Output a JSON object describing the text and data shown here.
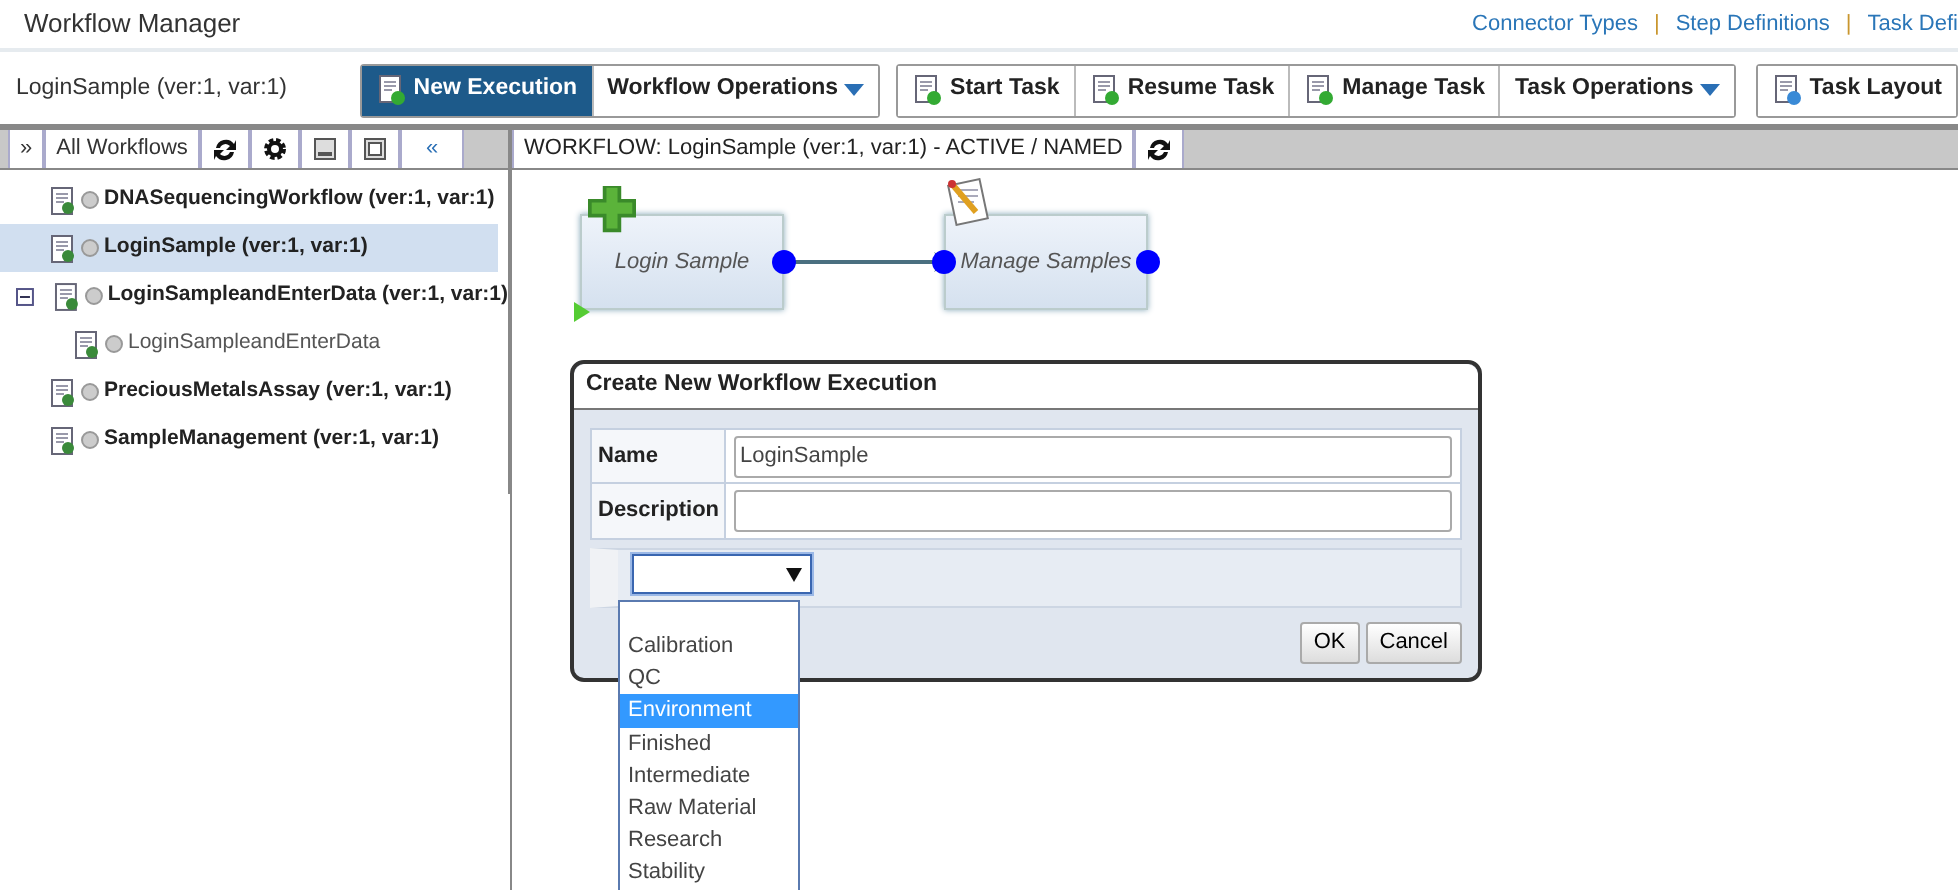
{
  "app_title": "Workflow Manager",
  "header_links": [
    "Connector Types",
    "Step Definitions",
    "Task Defi"
  ],
  "link_separator": "|",
  "current_workflow": "LoginSample (ver:1, var:1)",
  "workflow_buttons": [
    {
      "label": "New Execution",
      "kind": "action",
      "active": true
    },
    {
      "label": "Workflow Operations",
      "kind": "dropdown",
      "active": false
    }
  ],
  "task_buttons": [
    {
      "label": "Start Task",
      "kind": "action"
    },
    {
      "label": "Resume Task",
      "kind": "action"
    },
    {
      "label": "Manage Task",
      "kind": "action"
    },
    {
      "label": "Task Operations",
      "kind": "dropdown"
    }
  ],
  "layout_button": "Task Layout",
  "sidebar": {
    "expand_glyph": "»",
    "filter_label": "All Workflows",
    "collapse_glyph": "«",
    "items": [
      {
        "label": "DNASequencingWorkflow (ver:1, var:1)",
        "selected": false
      },
      {
        "label": "LoginSample (ver:1, var:1)",
        "selected": true
      },
      {
        "label": "LoginSampleandEnterData (ver:1, var:1)",
        "selected": false,
        "expanded": true,
        "children": [
          {
            "label": "LoginSampleandEnterData",
            "selected": false
          }
        ]
      },
      {
        "label": "PreciousMetalsAssay (ver:1, var:1)",
        "selected": false
      },
      {
        "label": "SampleManagement (ver:1, var:1)",
        "selected": false
      }
    ]
  },
  "canvas": {
    "title": "WORKFLOW: LoginSample (ver:1, var:1) - ACTIVE / NAMED",
    "nodes": [
      {
        "label": "Login Sample",
        "kind": "start"
      },
      {
        "label": "Manage Samples",
        "kind": "task"
      }
    ]
  },
  "dialog": {
    "title": "Create New Workflow Execution",
    "fields": [
      {
        "label": "Name",
        "value": "LoginSample"
      },
      {
        "label": "Description"
      }
    ],
    "select": {
      "expanded": true,
      "options": [
        {
          "label": "Calibration",
          "selected": false
        },
        {
          "label": "QC",
          "selected": false
        },
        {
          "label": "Environment",
          "selected": true
        },
        {
          "label": "Finished",
          "selected": false
        },
        {
          "label": "Intermediate",
          "selected": false
        },
        {
          "label": "Raw Material",
          "selected": false
        },
        {
          "label": "Research",
          "selected": false
        },
        {
          "label": "Stability",
          "selected": false
        }
      ]
    },
    "buttons": [
      "OK",
      "Cancel"
    ]
  }
}
